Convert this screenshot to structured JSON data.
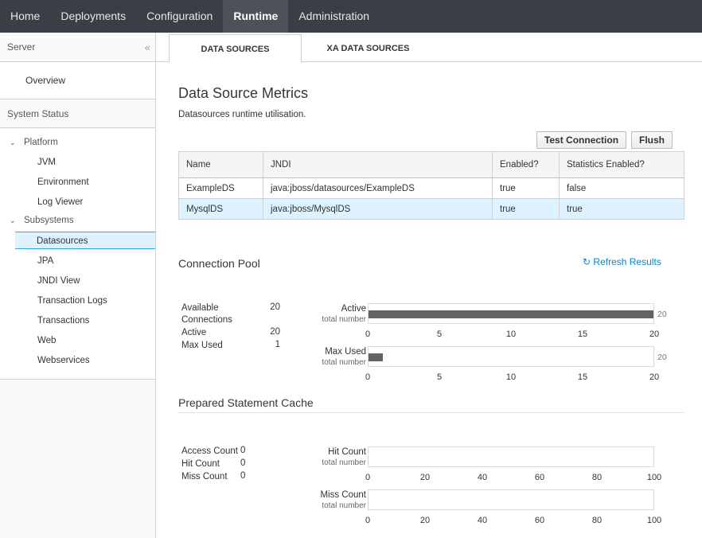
{
  "nav": {
    "items": [
      "Home",
      "Deployments",
      "Configuration",
      "Runtime",
      "Administration"
    ],
    "active": "Runtime"
  },
  "sidebar": {
    "header": "Server",
    "collapse_icon": "double-chevron-left-icon",
    "overview": "Overview",
    "section": "System Status",
    "platform": {
      "label": "Platform",
      "items": [
        "JVM",
        "Environment",
        "Log Viewer"
      ]
    },
    "subsystems": {
      "label": "Subsystems",
      "items": [
        "Datasources",
        "JPA",
        "JNDI View",
        "Transaction Logs",
        "Transactions",
        "Web",
        "Webservices"
      ],
      "selected": "Datasources"
    }
  },
  "tabs": [
    "DATA SOURCES",
    "XA DATA SOURCES"
  ],
  "page": {
    "title": "Data Source Metrics",
    "subtitle": "Datasources runtime utilisation.",
    "buttons": {
      "test": "Test Connection",
      "flush": "Flush"
    }
  },
  "table": {
    "headers": [
      "Name",
      "JNDI",
      "Enabled?",
      "Statistics Enabled?"
    ],
    "rows": [
      [
        "ExampleDS",
        "java:jboss/datasources/ExampleDS",
        "true",
        "false"
      ],
      [
        "MysqlDS",
        "java:jboss/MysqlDS",
        "true",
        "true"
      ]
    ],
    "selected_row": 1
  },
  "pool": {
    "title": "Connection Pool",
    "refresh": "Refresh Results",
    "refresh_icon": "refresh-icon",
    "stats": [
      {
        "label": "Available\nConnections",
        "value": "20"
      },
      {
        "label": "Active",
        "value": "20"
      },
      {
        "label": "Max Used",
        "value": "1"
      }
    ],
    "bars": [
      {
        "label": "Active",
        "sub": "total number",
        "value": 20,
        "max": 20,
        "max_label": "20"
      },
      {
        "label": "Max Used",
        "sub": "total number",
        "value": 1,
        "max": 20,
        "max_label": "20"
      }
    ],
    "ticks": [
      "0",
      "5",
      "10",
      "15",
      "20"
    ]
  },
  "cache": {
    "title": "Prepared Statement Cache",
    "stats": [
      {
        "label": "Access Count",
        "value": "0"
      },
      {
        "label": "Hit Count",
        "value": "0"
      },
      {
        "label": "Miss Count",
        "value": "0"
      }
    ],
    "bars": [
      {
        "label": "Hit Count",
        "sub": "total number",
        "value": 0,
        "max": 100
      },
      {
        "label": "Miss Count",
        "sub": "total number",
        "value": 0,
        "max": 100
      }
    ],
    "ticks": [
      "0",
      "20",
      "40",
      "60",
      "80",
      "100"
    ]
  },
  "colors": {
    "nav_bg": "#393f44",
    "nav_active_bg": "#4d5258",
    "accent": "#0088ce",
    "selected_bg": "#def3ff",
    "selected_border": "#39a5dc",
    "bar_fill": "#636363"
  }
}
